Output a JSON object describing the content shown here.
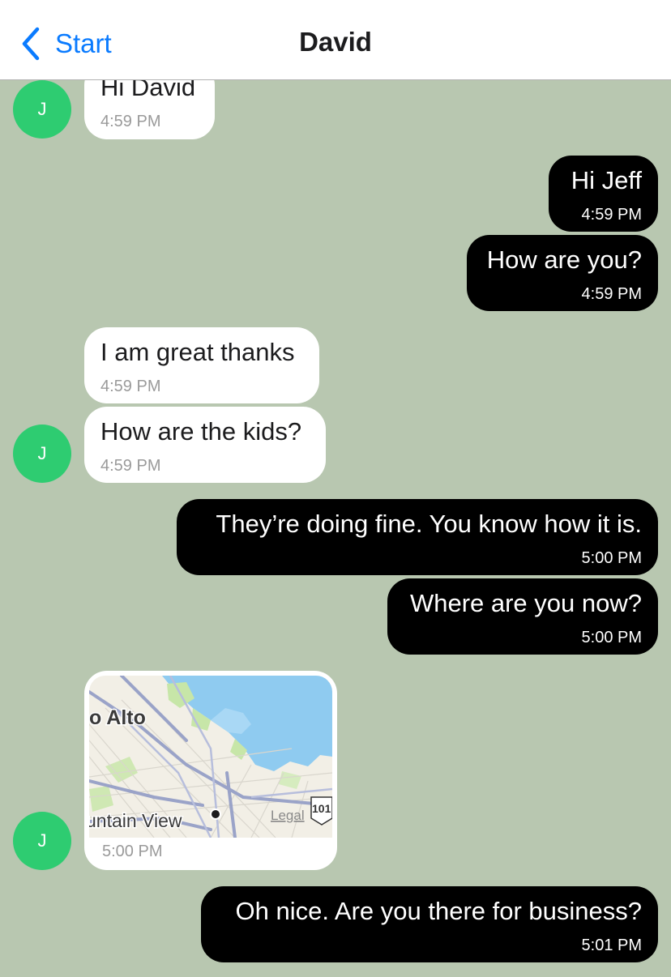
{
  "nav": {
    "back_label": "Start",
    "title": "David"
  },
  "avatar_initial": "J",
  "messages": [
    {
      "text": "Hi David",
      "time": "4:59 PM"
    },
    {
      "text": "Hi Jeff",
      "time": "4:59 PM"
    },
    {
      "text": "How are you?",
      "time": "4:59 PM"
    },
    {
      "text": "I am great thanks",
      "time": "4:59 PM"
    },
    {
      "text": "How are the kids?",
      "time": "4:59 PM"
    },
    {
      "text": "They’re doing fine. You know how it is.",
      "time": "5:00 PM"
    },
    {
      "text": "Where are you now?",
      "time": "5:00 PM"
    },
    {
      "time": "5:00 PM",
      "map": {
        "city_label": "o Alto",
        "city_label_2": "untain View",
        "legal_label": "Legal",
        "highway_shield": "101"
      }
    },
    {
      "text": "Oh nice. Are you there for business?",
      "time": "5:01 PM"
    }
  ],
  "colors": {
    "background": "#b8c7b0",
    "incoming_bubble": "#ffffff",
    "outgoing_bubble": "#000000",
    "avatar": "#2ecc71",
    "accent": "#0a7bff"
  }
}
